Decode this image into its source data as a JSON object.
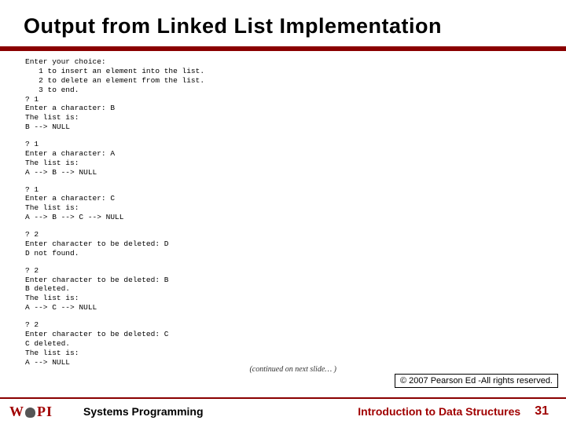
{
  "title": "Output from Linked List Implementation",
  "blocks": {
    "menu": "Enter your choice:\n   1 to insert an element into the list.\n   2 to delete an element from the list.\n   3 to end.\n? 1\nEnter a character: B\nThe list is:\nB --> NULL",
    "insertA": "? 1\nEnter a character: A\nThe list is:\nA --> B --> NULL",
    "insertC": "? 1\nEnter a character: C\nThe list is:\nA --> B --> C --> NULL",
    "deleteD": "? 2\nEnter character to be deleted: D\nD not found.",
    "deleteB": "? 2\nEnter character to be deleted: B\nB deleted.\nThe list is:\nA --> C --> NULL",
    "deleteC": "? 2\nEnter character to be deleted: C\nC deleted.\nThe list is:\nA --> NULL"
  },
  "continued": "(continued on next slide… )",
  "copyright": "© 2007 Pearson Ed -All rights reserved.",
  "footer": {
    "course": "Systems Programming",
    "topic": "Introduction to Data Structures",
    "page": "31"
  },
  "logo": {
    "w": "W",
    "p": "P",
    "i": "I"
  }
}
